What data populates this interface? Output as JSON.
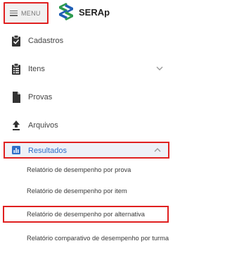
{
  "header": {
    "menu_label": "MENU",
    "brand": "SERAp"
  },
  "sidebar": {
    "items": [
      {
        "label": "Cadastros",
        "icon": "clipboard-check-icon"
      },
      {
        "label": "Itens",
        "icon": "clipboard-list-icon",
        "expand": "chevron-down-icon"
      },
      {
        "label": "Provas",
        "icon": "file-icon"
      },
      {
        "label": "Arquivos",
        "icon": "upload-icon"
      },
      {
        "label": "Resultados",
        "icon": "bar-chart-icon",
        "expand": "chevron-up-icon",
        "active": true
      }
    ],
    "submenu": [
      "Relatório de desempenho por prova",
      "Relatório de desempenho por item",
      "Relatório de desempenho por alternativa",
      "Relatório comparativo de desempenho por turma"
    ]
  },
  "colors": {
    "highlight_border": "#e02020",
    "active_text": "#2f6fc9",
    "active_background": "#eef1f7",
    "logo_green": "#2e9b4f",
    "logo_blue": "#1f5fb5"
  }
}
